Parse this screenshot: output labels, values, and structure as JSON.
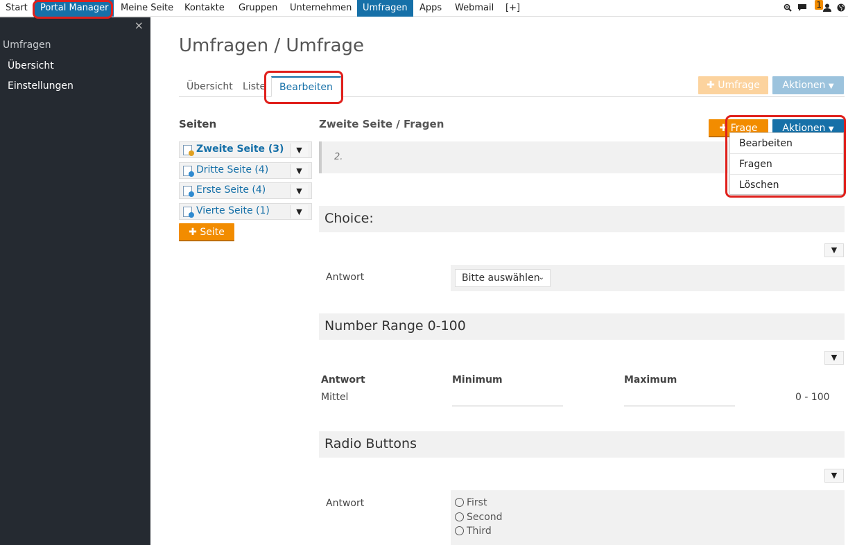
{
  "topnav": {
    "items": [
      "Start",
      "Portal Manager",
      "Meine Seite",
      "Kontakte",
      "Gruppen",
      "Unternehmen",
      "Umfragen",
      "Apps",
      "Webmail",
      "[+]"
    ],
    "notification_count": "1",
    "icons": [
      "zoom-icon",
      "chat-icon",
      "user-icon",
      "globe-icon"
    ]
  },
  "sidebar": {
    "close": "×",
    "section": "Umfragen",
    "links": [
      "Übersicht",
      "Einstellungen"
    ]
  },
  "main": {
    "title": "Umfragen / Umfrage",
    "tabs": [
      "Übersicht",
      "Liste",
      "Bearbeiten"
    ],
    "add_survey": "Umfrage",
    "actions": "Aktionen"
  },
  "pages": {
    "heading": "Seiten",
    "items": [
      "Zweite Seite (3)",
      "Dritte Seite (4)",
      "Erste Seite (4)",
      "Vierte Seite (1)"
    ],
    "add_label": "Seite"
  },
  "questions": {
    "heading": "Zweite Seite / Fragen",
    "add_label": "Frage",
    "actions": "Aktionen",
    "description": "2.",
    "dropdown": [
      "Bearbeiten",
      "Fragen",
      "Löschen"
    ],
    "choice": {
      "title": "Choice:",
      "answer_label": "Antwort",
      "select_value": "Bitte auswählen"
    },
    "range": {
      "title": "Number Range 0-100",
      "col_answer": "Antwort",
      "col_min": "Minimum",
      "col_max": "Maximum",
      "row_label": "Mittel",
      "range_text": "0 - 100"
    },
    "radio": {
      "title": "Radio Buttons",
      "answer_label": "Antwort",
      "options": [
        "First",
        "Second",
        "Third"
      ]
    }
  },
  "colors": {
    "accent_blue": "#1670a8",
    "accent_orange": "#f28c00",
    "sidebar_bg": "#252a31",
    "highlight_red": "#e0201c"
  }
}
